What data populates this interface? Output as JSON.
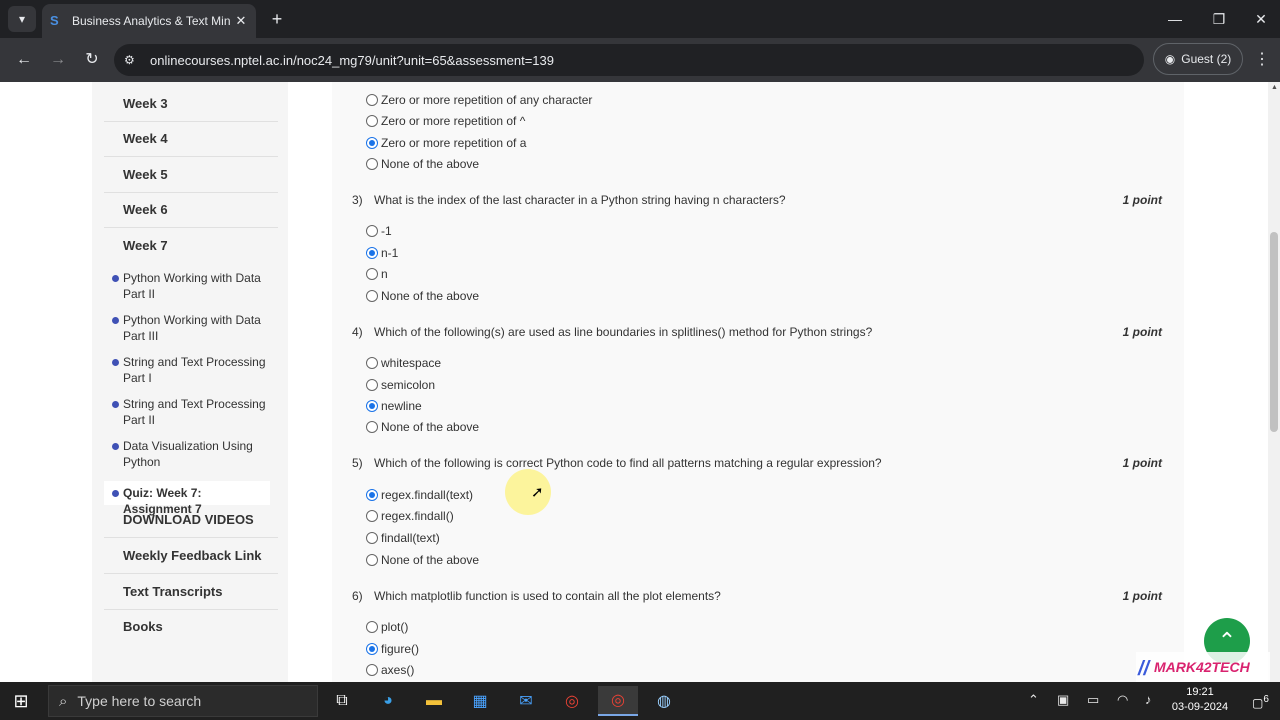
{
  "browser": {
    "tab_title": "Business Analytics & Text Minin",
    "url": "onlinecourses.nptel.ac.in/noc24_mg79/unit?unit=65&assessment=139",
    "guest_label": "Guest (2)"
  },
  "sidebar": {
    "weeks": [
      "Week 3",
      "Week 4",
      "Week 5",
      "Week 6",
      "Week 7"
    ],
    "units": [
      {
        "label": "Python Working with Data Part II"
      },
      {
        "label": "Python Working with Data Part III"
      },
      {
        "label": "String and Text Processing Part I"
      },
      {
        "label": "String and Text Processing Part II"
      },
      {
        "label": "Data Visualization Using Python"
      }
    ],
    "active_quiz": "Quiz: Week 7: Assignment 7",
    "links": [
      "DOWNLOAD VIDEOS",
      "Weekly Feedback Link",
      "Text Transcripts",
      "Books"
    ]
  },
  "quiz": {
    "q2_options": [
      {
        "label": "Zero or more repetition of any character",
        "checked": false
      },
      {
        "label": "Zero or more repetition of  ^",
        "checked": false
      },
      {
        "label": "Zero or more repetition of  a",
        "checked": true
      },
      {
        "label": "None of the above",
        "checked": false
      }
    ],
    "questions": [
      {
        "number": "3)",
        "text": "What is the index of the last character in a Python string having n characters?",
        "points": "1 point",
        "options": [
          {
            "label": "-1",
            "checked": false
          },
          {
            "label": "n-1",
            "checked": true
          },
          {
            "label": "n",
            "checked": false
          },
          {
            "label": "None of the above",
            "checked": false
          }
        ]
      },
      {
        "number": "4)",
        "text": "Which of the following(s) are used as line boundaries in splitlines() method for Python strings?",
        "points": "1 point",
        "options": [
          {
            "label": "whitespace",
            "checked": false
          },
          {
            "label": "semicolon",
            "checked": false
          },
          {
            "label": "newline",
            "checked": true
          },
          {
            "label": "None of the above",
            "checked": false
          }
        ]
      },
      {
        "number": "5)",
        "text": "Which of the following is correct Python code to find all patterns matching a regular expression?",
        "points": "1 point",
        "options": [
          {
            "label": "regex.findall(text)",
            "checked": true
          },
          {
            "label": "regex.findall()",
            "checked": false
          },
          {
            "label": "findall(text)",
            "checked": false
          },
          {
            "label": "None of the above",
            "checked": false
          }
        ]
      },
      {
        "number": "6)",
        "text": "Which matplotlib function is used to contain all the plot elements?",
        "points": "1 point",
        "options": [
          {
            "label": "plot()",
            "checked": false
          },
          {
            "label": "figure()",
            "checked": true
          },
          {
            "label": "axes()",
            "checked": false
          }
        ]
      }
    ]
  },
  "watermark": "MARK42TECH",
  "taskbar": {
    "search_placeholder": "Type here to search",
    "time": "19:21",
    "date": "03-09-2024",
    "notifications": "6"
  }
}
